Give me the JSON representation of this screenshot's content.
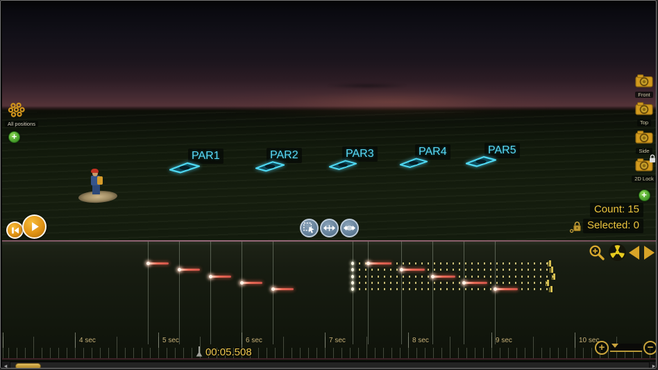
{
  "icons": {
    "plus": "+",
    "minus": "−",
    "scroll_left": "◂",
    "scroll_right": "▸"
  },
  "viewport": {
    "all_positions_label": "All positions",
    "positions": [
      {
        "label": "PAR1"
      },
      {
        "label": "PAR2"
      },
      {
        "label": "PAR3"
      },
      {
        "label": "PAR4"
      },
      {
        "label": "PAR5"
      }
    ],
    "camera_views": [
      {
        "label": "Front",
        "locked": false
      },
      {
        "label": "Top",
        "locked": false
      },
      {
        "label": "Side",
        "locked": false
      },
      {
        "label": "2D Lock",
        "locked": true
      }
    ],
    "count_text": "Count: 15",
    "selected_text": "Selected: 0"
  },
  "timeline": {
    "playhead_time_text": "00:05.508",
    "playhead_seconds": 5.508,
    "ruler_labels": [
      {
        "t": 4,
        "text": "4 sec"
      },
      {
        "t": 5,
        "text": "5 sec"
      },
      {
        "t": 6,
        "text": "6 sec"
      },
      {
        "t": 7,
        "text": "7 sec"
      },
      {
        "t": 8,
        "text": "8 sec"
      },
      {
        "t": 9,
        "text": "9 sec"
      },
      {
        "t": 10,
        "text": "10 sec"
      }
    ],
    "track_count": 5,
    "cues": [
      {
        "track": 1,
        "start": 4.875,
        "end": 5.125
      },
      {
        "track": 2,
        "start": 5.25,
        "end": 5.5
      },
      {
        "track": 3,
        "start": 5.625,
        "end": 5.875
      },
      {
        "track": 4,
        "start": 6.0,
        "end": 6.25
      },
      {
        "track": 5,
        "start": 6.375,
        "end": 6.625
      },
      {
        "track": 1,
        "start": 7.52,
        "end": 7.8
      },
      {
        "track": 2,
        "start": 7.92,
        "end": 8.2
      },
      {
        "track": 3,
        "start": 8.29,
        "end": 8.57
      },
      {
        "track": 4,
        "start": 8.67,
        "end": 8.95
      },
      {
        "track": 5,
        "start": 9.04,
        "end": 9.32
      }
    ],
    "sustains": [
      {
        "track": 1,
        "start": 7.33,
        "end": 9.69
      },
      {
        "track": 2,
        "start": 7.33,
        "end": 9.72
      },
      {
        "track": 3,
        "start": 7.33,
        "end": 9.74
      },
      {
        "track": 4,
        "start": 7.33,
        "end": 9.67
      },
      {
        "track": 5,
        "start": 7.33,
        "end": 9.71
      }
    ],
    "gridline_times": [
      4.875,
      5.25,
      5.625,
      6.0,
      6.375,
      7.33,
      7.52,
      7.92,
      8.29,
      8.67,
      9.04
    ]
  },
  "colors": {
    "accent_gold": "#d2a02a",
    "label_cyan": "#55d6f2",
    "event_red": "#e2584a",
    "sustain_dot_gold": "#c6ba74",
    "tool_blue": "#7a93aa",
    "add_green": "#4fae3c",
    "divider_pink": "#8a5f6b"
  }
}
